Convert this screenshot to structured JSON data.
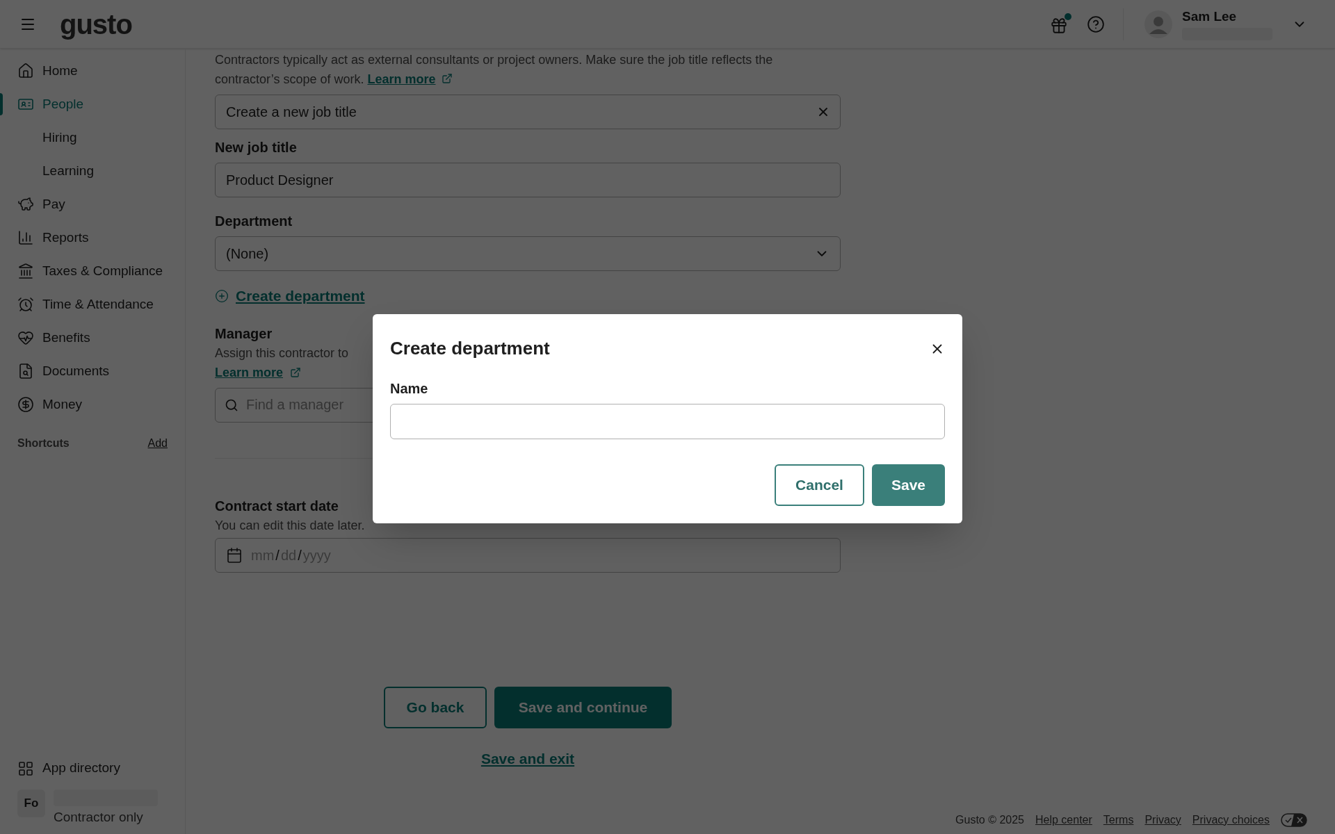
{
  "header": {
    "logo": "gusto",
    "user": {
      "name": "Sam Lee"
    }
  },
  "sidebar": {
    "items": [
      {
        "label": "Home",
        "selected": false
      },
      {
        "label": "People",
        "selected": true,
        "children": [
          {
            "label": "Hiring",
            "selected": false
          },
          {
            "label": "Learning",
            "selected": false
          }
        ]
      },
      {
        "label": "Pay",
        "selected": false
      },
      {
        "label": "Reports",
        "selected": false
      },
      {
        "label": "Taxes & Compliance",
        "selected": false
      },
      {
        "label": "Time & Attendance",
        "selected": false
      },
      {
        "label": "Benefits",
        "selected": false
      },
      {
        "label": "Documents",
        "selected": false
      },
      {
        "label": "Money",
        "selected": false
      }
    ],
    "shortcuts": {
      "title": "Shortcuts",
      "action": "Add"
    },
    "app_directory": "App directory",
    "company": {
      "initials": "Fo",
      "plan": "Contractor only"
    }
  },
  "form": {
    "intro": "Contractors typically act as external consultants or project owners. Make sure the job title reflects the contractor’s scope of work.",
    "intro_link": "Learn more",
    "job_title_select": {
      "value": "Create a new job title"
    },
    "new_job_title": {
      "label": "New job title",
      "value": "Product Designer"
    },
    "department": {
      "label": "Department",
      "value": "(None)"
    },
    "create_department": "Create department",
    "manager": {
      "label": "Manager",
      "description": "Assign this contractor to",
      "link": "Learn more",
      "placeholder": "Find a manager"
    },
    "start_date": {
      "label": "Contract start date",
      "description": "You can edit this date later.",
      "parts": [
        {
          "text": "mm",
          "kind": "placeholder"
        },
        {
          "text": "/",
          "kind": "separator"
        },
        {
          "text": "dd",
          "kind": "placeholder"
        },
        {
          "text": "/",
          "kind": "separator"
        },
        {
          "text": "yyyy",
          "kind": "placeholder"
        }
      ]
    }
  },
  "actions": {
    "back": "Go back",
    "continue": "Save and continue",
    "exit": "Save and exit"
  },
  "footer": {
    "copyright": "Gusto © 2025",
    "links": [
      "Help center",
      "Terms",
      "Privacy",
      "Privacy choices"
    ]
  },
  "modal": {
    "title": "Create department",
    "field_label": "Name",
    "buttons": [
      {
        "label": "Cancel",
        "kind": "secondary"
      },
      {
        "label": "Save",
        "kind": "primary"
      }
    ]
  }
}
